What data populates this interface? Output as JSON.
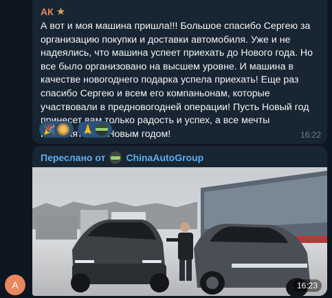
{
  "message1": {
    "author": "АК",
    "text": "А вот и моя машина пришла!!! Большое спасибо Сергею за организацию покупки и доставки автомобиля. Уже и не надеялись, что машина успеет приехать до Нового года. Но все было организовано на высшем уровне. И машина в качестве новогоднего подарка успела приехать! Еще раз спасибо Сергею и всем его компаньонам, которые участвовали в предновогодней операции! Пусть Новый год принесет вам только радость и успех, а все мечты исполнятся! С Новым годом!",
    "time": "16:22",
    "reactions": [
      {
        "emoji": "🎉"
      },
      {
        "emoji": "🙏"
      }
    ]
  },
  "message2": {
    "forwarded_prefix": "Переслано от",
    "channel": "ChinaAutoGroup",
    "time": "16:23"
  },
  "avatar_letter": "A",
  "colors": {
    "background": "#0e1621",
    "bubble": "#182533",
    "author": "#e8885e",
    "link": "#5fb0f0",
    "reaction_bg": "#2b5278"
  }
}
